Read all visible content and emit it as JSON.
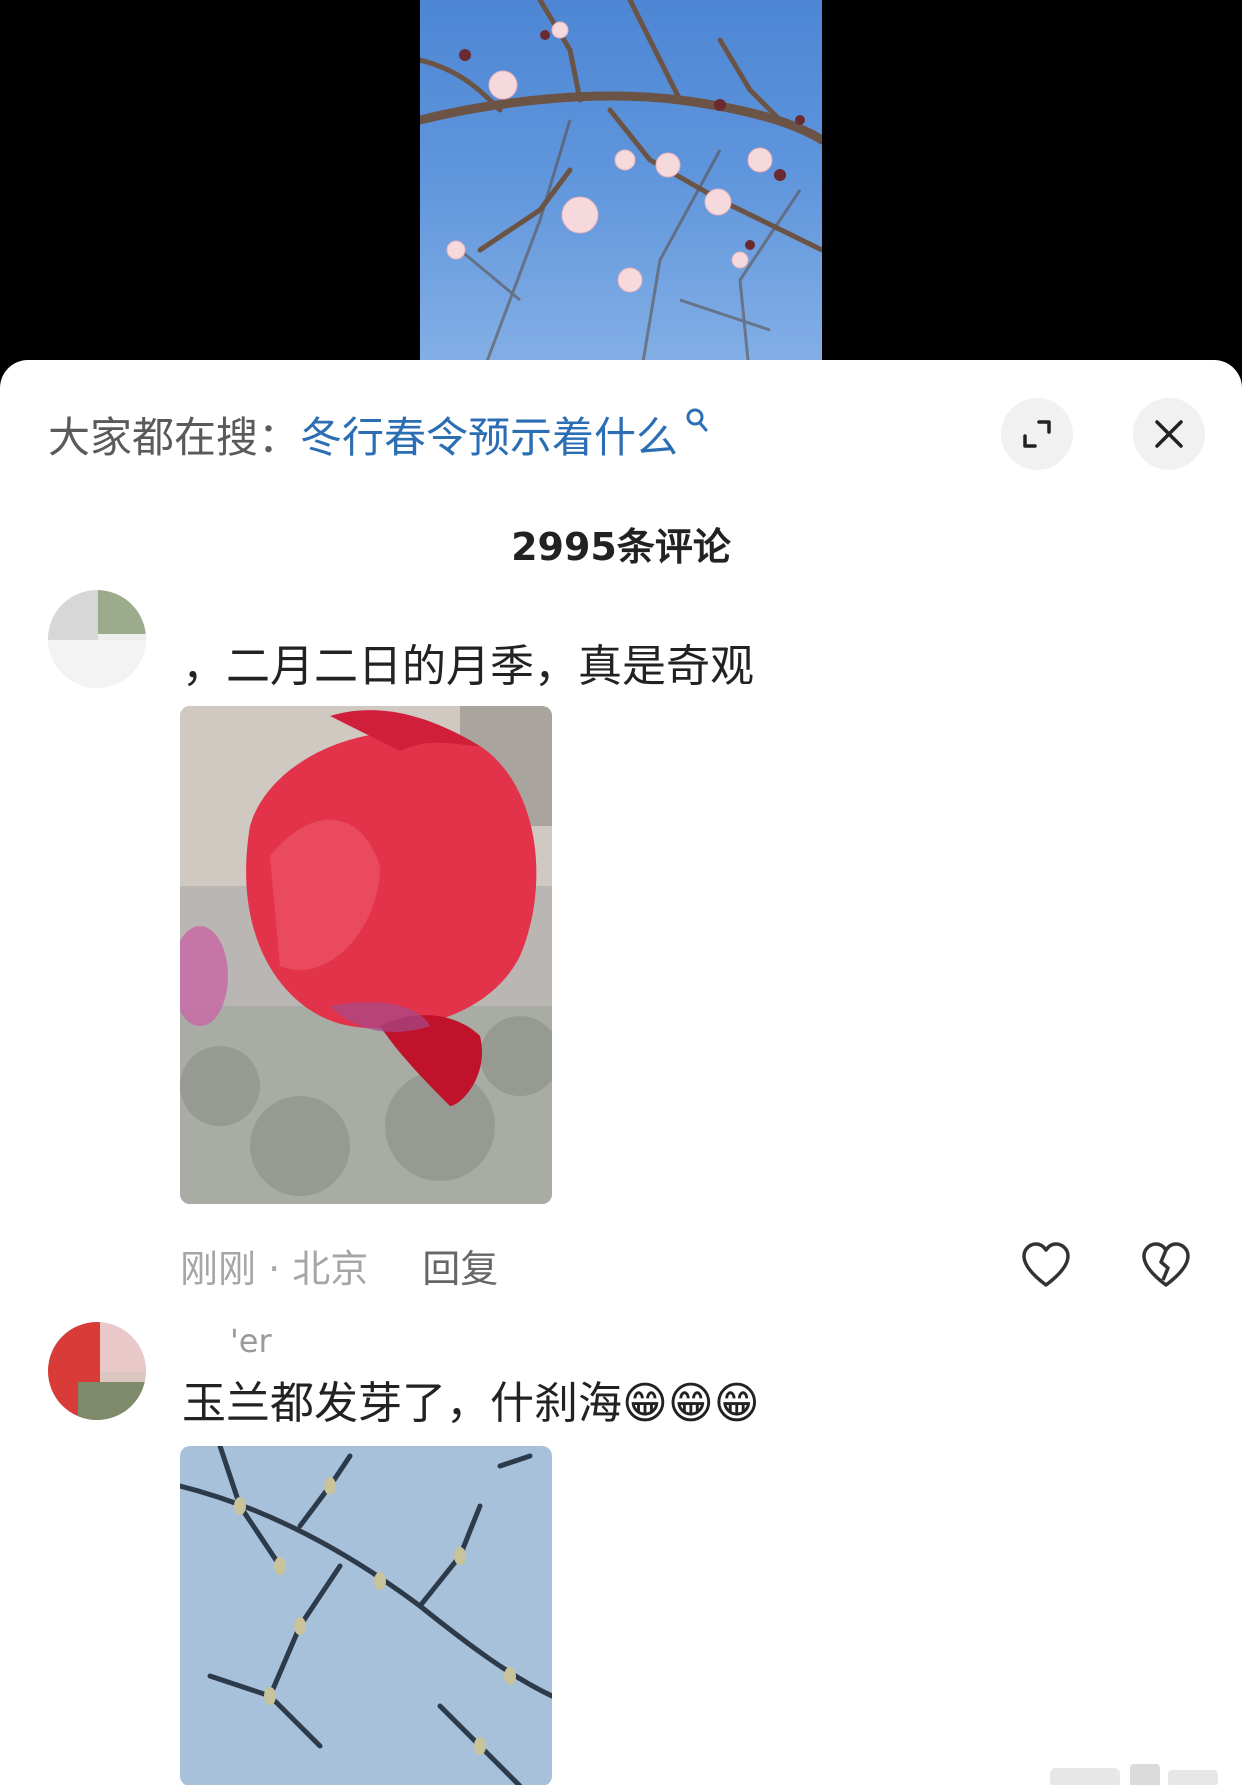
{
  "search": {
    "prefix": "大家都在搜：",
    "query": "冬行春令预示着什么",
    "glass_icon": "search-icon"
  },
  "buttons": {
    "expand_icon": "expand-icon",
    "close_icon": "close-icon"
  },
  "comments_header": {
    "title": "2995条评论"
  },
  "comments": [
    {
      "text": "，二月二日的月季，真是奇观",
      "time": "刚刚 · 北京",
      "reply": "回复",
      "image_subject": "red-rose-bud",
      "like_icon": "heart-icon",
      "dislike_icon": "broken-heart-icon"
    },
    {
      "username": "'er",
      "text": "玉兰都发芽了，什刹海😁😁😁",
      "image_subject": "magnolia-branches"
    }
  ],
  "colors": {
    "query_blue": "#2c6eb3",
    "text_dark": "#222222",
    "text_gray": "#a6a6a6"
  }
}
